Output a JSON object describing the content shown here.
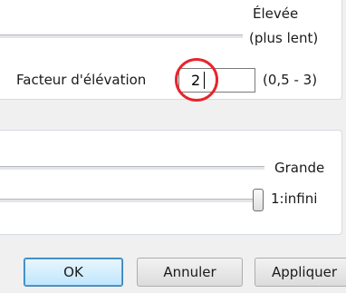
{
  "upper_group": {
    "slider_end_label_line1": "Élevée",
    "slider_end_label_line2": "(plus lent)",
    "elevation_factor": {
      "label": "Facteur d'élévation",
      "value": "2",
      "range_hint": "(0,5 - 3)"
    }
  },
  "lower_group": {
    "slider_end_label": "Grande",
    "scale_slider": {
      "value_label": "1:infini",
      "level": 1.0
    }
  },
  "buttons": {
    "ok": "OK",
    "cancel": "Annuler",
    "apply": "Appliquer"
  },
  "colors": {
    "highlight_circle": "#e8242c",
    "default_button_border": "#3c7fb1"
  }
}
